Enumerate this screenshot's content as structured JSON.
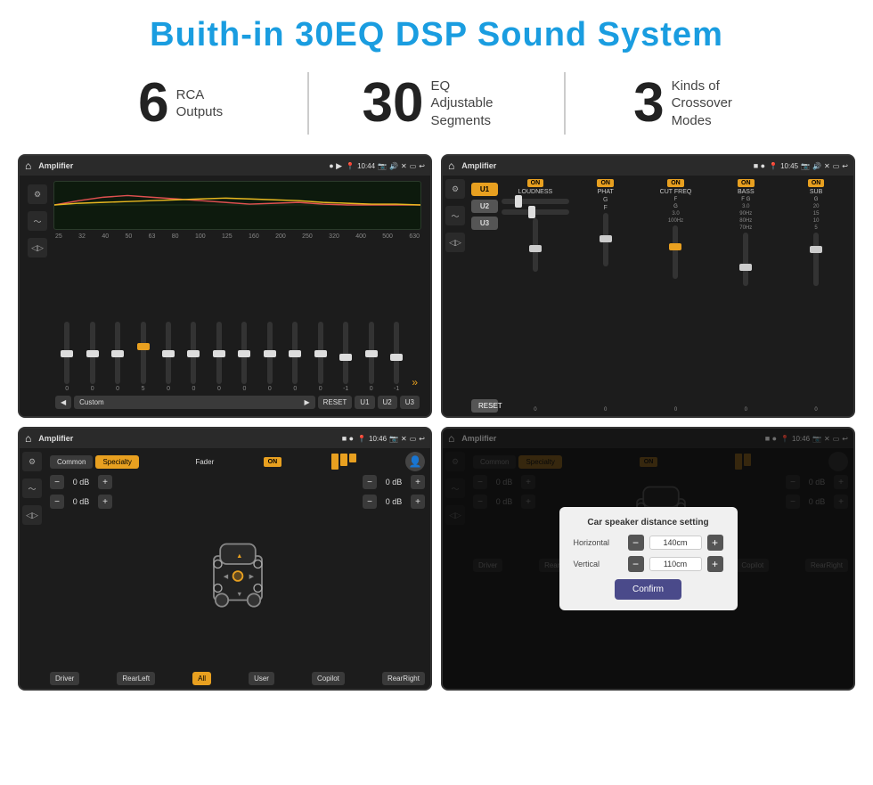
{
  "page": {
    "title": "Buith-in 30EQ DSP Sound System",
    "stats": [
      {
        "number": "6",
        "text": "RCA\nOutputs"
      },
      {
        "number": "30",
        "text": "EQ Adjustable\nSegments"
      },
      {
        "number": "3",
        "text": "Kinds of\nCrossover Modes"
      }
    ]
  },
  "screens": {
    "eq": {
      "title": "Amplifier",
      "time": "10:44",
      "frequencies": [
        "25",
        "32",
        "40",
        "50",
        "63",
        "80",
        "100",
        "125",
        "160",
        "200",
        "250",
        "320",
        "400",
        "500",
        "630"
      ],
      "values": [
        "0",
        "0",
        "0",
        "5",
        "0",
        "0",
        "0",
        "0",
        "0",
        "0",
        "0",
        "-1",
        "0",
        "-1"
      ],
      "preset": "Custom",
      "buttons": [
        "RESET",
        "U1",
        "U2",
        "U3"
      ]
    },
    "crossover": {
      "title": "Amplifier",
      "time": "10:45",
      "presets": [
        "U1",
        "U2",
        "U3"
      ],
      "columns": [
        {
          "label": "LOUDNESS",
          "on": true
        },
        {
          "label": "PHAT",
          "on": true
        },
        {
          "label": "CUT FREQ",
          "on": true
        },
        {
          "label": "BASS",
          "on": true
        },
        {
          "label": "SUB",
          "on": true
        }
      ],
      "resetLabel": "RESET"
    },
    "fader": {
      "title": "Amplifier",
      "time": "10:46",
      "tabs": [
        "Common",
        "Specialty"
      ],
      "activeTab": "Specialty",
      "faderLabel": "Fader",
      "onLabel": "ON",
      "dbValues": [
        "0 dB",
        "0 dB",
        "0 dB",
        "0 dB"
      ],
      "buttons": [
        "Driver",
        "RearLeft",
        "All",
        "User",
        "Copilot",
        "RearRight"
      ]
    },
    "distance": {
      "title": "Amplifier",
      "time": "10:46",
      "tabs": [
        "Common",
        "Specialty"
      ],
      "activeTab": "Specialty",
      "onLabel": "ON",
      "dialog": {
        "title": "Car speaker distance setting",
        "horizontal": {
          "label": "Horizontal",
          "value": "140cm"
        },
        "vertical": {
          "label": "Vertical",
          "value": "110cm"
        },
        "confirmLabel": "Confirm"
      },
      "dbValues": [
        "0 dB",
        "0 dB"
      ],
      "buttons": [
        "Driver",
        "RearLeft...",
        "Copilot",
        "RearRight"
      ]
    }
  }
}
